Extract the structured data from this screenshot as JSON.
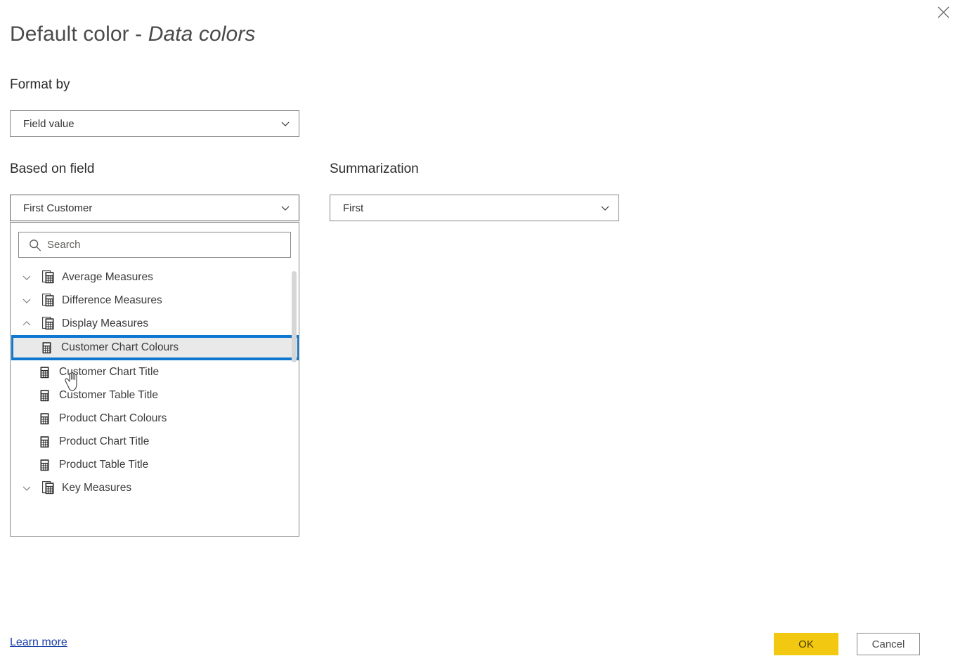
{
  "dialog": {
    "title_main": "Default color - ",
    "title_italic": "Data colors",
    "close_icon": "close-icon"
  },
  "format_by": {
    "label": "Format by",
    "value": "Field value"
  },
  "based_on_field": {
    "label": "Based on field",
    "value": "First Customer"
  },
  "summarization": {
    "label": "Summarization",
    "value": "First"
  },
  "dropdown": {
    "search_placeholder": "Search",
    "search_value": "",
    "search_icon": "search-icon",
    "items": [
      {
        "label": "Average Measures",
        "level": "group",
        "expanded": false,
        "selected": false,
        "icon": "measure-folder-icon"
      },
      {
        "label": "Difference Measures",
        "level": "group",
        "expanded": false,
        "selected": false,
        "icon": "measure-folder-icon"
      },
      {
        "label": "Display Measures",
        "level": "group",
        "expanded": true,
        "selected": false,
        "icon": "measure-folder-icon"
      },
      {
        "label": "Customer Chart Colours",
        "level": "child",
        "expanded": null,
        "selected": true,
        "icon": "measure-icon"
      },
      {
        "label": "Customer Chart Title",
        "level": "child",
        "expanded": null,
        "selected": false,
        "icon": "measure-icon"
      },
      {
        "label": "Customer Table Title",
        "level": "child",
        "expanded": null,
        "selected": false,
        "icon": "measure-icon"
      },
      {
        "label": "Product Chart Colours",
        "level": "child",
        "expanded": null,
        "selected": false,
        "icon": "measure-icon"
      },
      {
        "label": "Product Chart Title",
        "level": "child",
        "expanded": null,
        "selected": false,
        "icon": "measure-icon"
      },
      {
        "label": "Product Table Title",
        "level": "child",
        "expanded": null,
        "selected": false,
        "icon": "measure-icon"
      },
      {
        "label": "Key Measures",
        "level": "group",
        "expanded": false,
        "selected": false,
        "icon": "measure-folder-icon"
      }
    ]
  },
  "footer": {
    "learn_more": "Learn more",
    "ok": "OK",
    "cancel": "Cancel"
  },
  "colors": {
    "accent_yellow": "#f2c811",
    "selection_blue": "#0f77d0",
    "link_blue": "#1a3fa8",
    "border_gray": "#8a8886"
  }
}
